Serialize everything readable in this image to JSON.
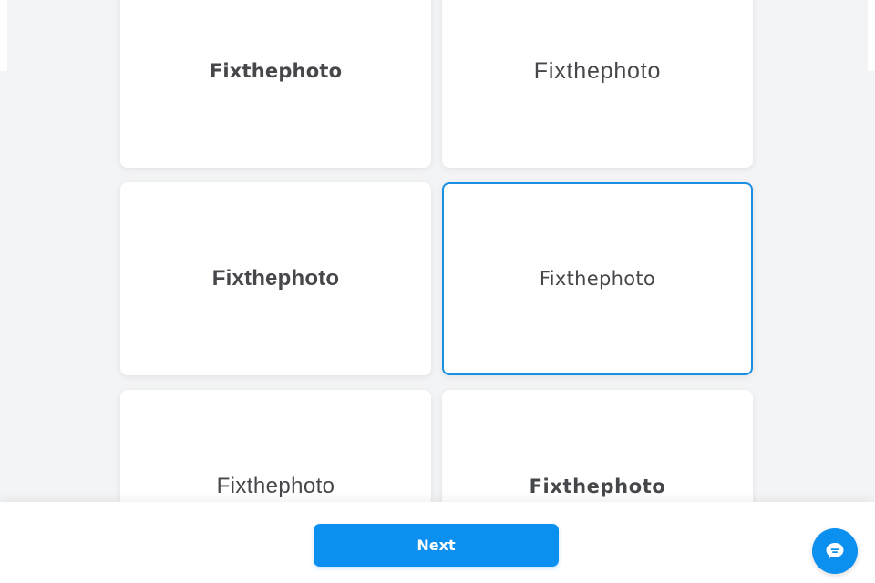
{
  "logos": [
    {
      "label": "Fixthephoto"
    },
    {
      "label": "Fixthephoto"
    },
    {
      "label": "Fixthephoto"
    },
    {
      "label": "Fixthephoto",
      "selected": true
    },
    {
      "label": "Fixthephoto"
    },
    {
      "label": "Fixthephoto"
    }
  ],
  "footer": {
    "next_label": "Next"
  },
  "colors": {
    "accent": "#0b90f0",
    "selected_border": "#1a8fe3",
    "logo_text": "#45474a",
    "background": "#f3f4f5"
  },
  "icons": {
    "chat": "chat-bubble-icon"
  }
}
